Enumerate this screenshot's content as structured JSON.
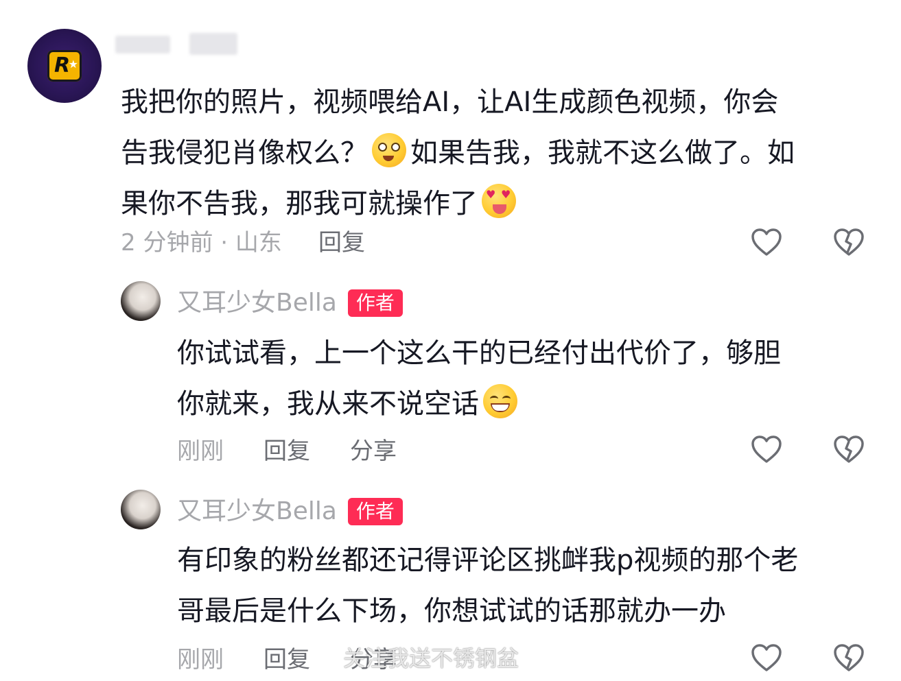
{
  "comment": {
    "line1": "我把你的照片，视频喂给AI，让AI生成颜色视频，你会",
    "line2a": "告我侵犯肖像权么？",
    "line2b": "如果告我，我就不这么做了。如",
    "line3": "果你不告我，那我可就操作了",
    "time_location": "2 分钟前 · 山东",
    "reply_label": "回复"
  },
  "replies": [
    {
      "name": "又耳少女Bella",
      "tag": "作者",
      "line1": "你试试看，上一个这么干的已经付出代价了，够胆",
      "line2": "你就来，我从来不说空话",
      "time": "刚刚",
      "reply_label": "回复",
      "share_label": "分享"
    },
    {
      "name": "又耳少女Bella",
      "tag": "作者",
      "line1": "有印象的粉丝都还记得评论区挑衅我p视频的那个老",
      "line2": "哥最后是什么下场，你想试试的话那就办一办",
      "time": "刚刚",
      "reply_label": "回复",
      "share_label": "分享"
    }
  ],
  "watermark": "关注我送不锈钢盆",
  "colors": {
    "author_tag": "#fe2c55",
    "meta_gray": "#a6a7ab",
    "text": "#161823"
  },
  "icons": [
    "heart-outline-icon",
    "broken-heart-icon",
    "smiley-emoji"
  ]
}
